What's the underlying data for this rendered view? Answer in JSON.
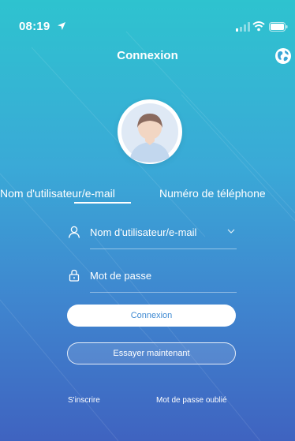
{
  "status_bar": {
    "time": "08:19"
  },
  "nav": {
    "title": "Connexion"
  },
  "tabs": [
    {
      "label": "Nom d'utilisateur/e-mail",
      "active": true
    },
    {
      "label": "Numéro de téléphone",
      "active": false
    }
  ],
  "form": {
    "username_placeholder": "Nom d'utilisateur/e-mail",
    "password_placeholder": "Mot de passe"
  },
  "buttons": {
    "login_label": "Connexion",
    "try_label": "Essayer maintenant"
  },
  "links": {
    "signup": "S'inscrire",
    "forgot": "Mot de passe oublié"
  },
  "colors": {
    "gradient_top": "#2ec3cf",
    "gradient_bottom": "#3f63c0",
    "login_text": "#3f8ad2"
  },
  "icons": [
    "location-arrow-icon",
    "signal-icon",
    "wifi-icon",
    "battery-icon",
    "globe-icon",
    "user-icon",
    "lock-icon",
    "chevron-down-icon"
  ]
}
